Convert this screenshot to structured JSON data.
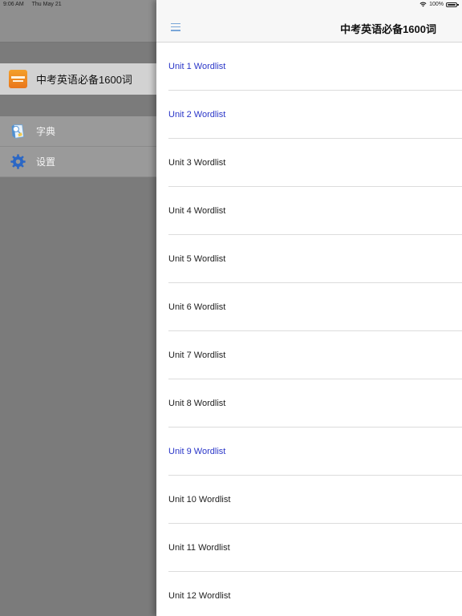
{
  "status_bar": {
    "time": "9:06 AM",
    "date": "Thu May 21",
    "battery": "100%"
  },
  "sidebar": {
    "app_title": "中考英语必备1600词",
    "items": [
      {
        "label": "字典",
        "icon": "dictionary-icon"
      },
      {
        "label": "设置",
        "icon": "gear-icon"
      }
    ]
  },
  "nav": {
    "title": "中考英语必备1600词",
    "menu_icon": "hamburger-menu-icon"
  },
  "colors": {
    "visited_link": "#2a36c8",
    "default_text": "#222222",
    "accent": "#7aa6d8"
  },
  "wordlists": [
    {
      "label": "Unit 1 Wordlist",
      "visited": true
    },
    {
      "label": "Unit 2 Wordlist",
      "visited": true
    },
    {
      "label": "Unit 3 Wordlist",
      "visited": false
    },
    {
      "label": "Unit 4 Wordlist",
      "visited": false
    },
    {
      "label": "Unit 5 Wordlist",
      "visited": false
    },
    {
      "label": "Unit 6 Wordlist",
      "visited": false
    },
    {
      "label": "Unit 7 Wordlist",
      "visited": false
    },
    {
      "label": "Unit 8 Wordlist",
      "visited": false
    },
    {
      "label": "Unit 9 Wordlist",
      "visited": true
    },
    {
      "label": "Unit 10 Wordlist",
      "visited": false
    },
    {
      "label": "Unit 11 Wordlist",
      "visited": false
    },
    {
      "label": "Unit 12 Wordlist",
      "visited": false
    }
  ]
}
